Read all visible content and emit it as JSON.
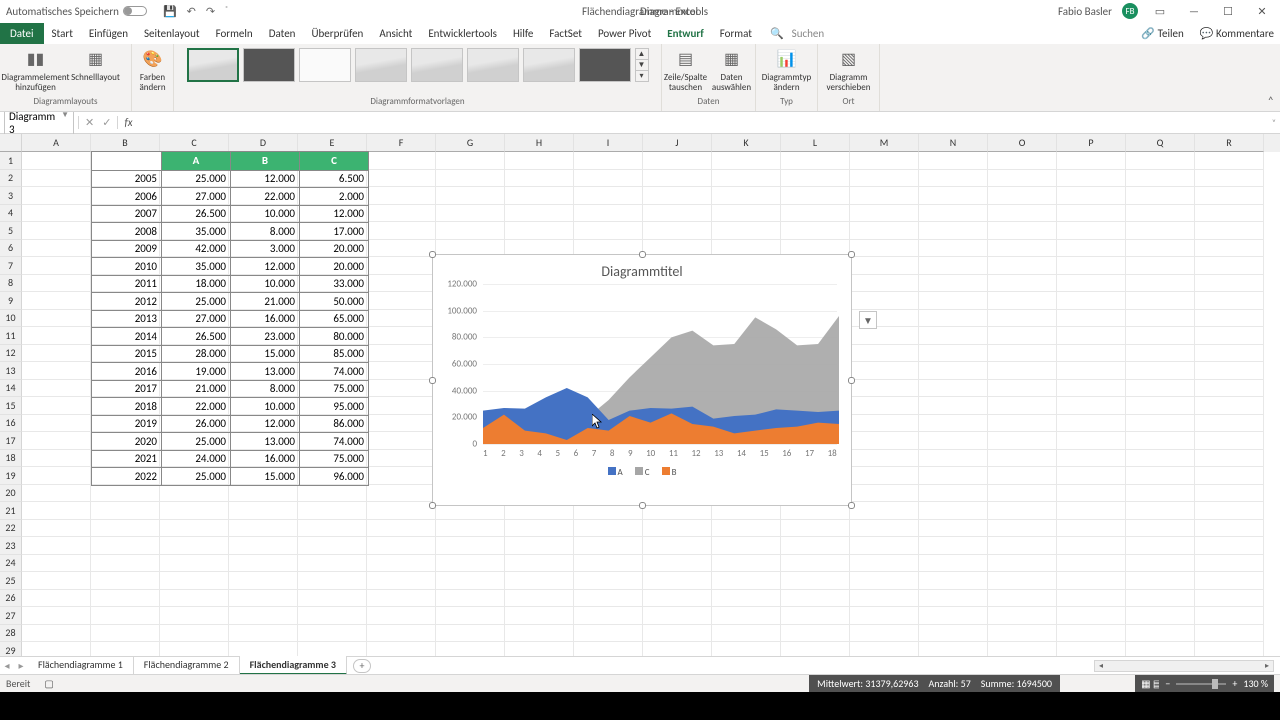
{
  "title_bar": {
    "autosave_label": "Automatisches Speichern",
    "doc_title": "Flächendiagramme - Excel",
    "context_tab": "Diagrammtools",
    "user_name": "Fabio Basler",
    "user_initials": "FB"
  },
  "tabs": {
    "file": "Datei",
    "items": [
      "Start",
      "Einfügen",
      "Seitenlayout",
      "Formeln",
      "Daten",
      "Überprüfen",
      "Ansicht",
      "Entwicklertools",
      "Hilfe",
      "FactSet",
      "Power Pivot",
      "Entwurf",
      "Format"
    ],
    "active": "Entwurf",
    "search": "Suchen",
    "share": "Teilen",
    "comments": "Kommentare"
  },
  "ribbon": {
    "layouts_btn1": "Diagrammelement hinzufügen",
    "layouts_btn2": "Schnelllayout",
    "layouts_label": "Diagrammlayouts",
    "colors_btn": "Farben ändern",
    "styles_label": "Diagrammformatvorlagen",
    "data_btn1": "Zeile/Spalte tauschen",
    "data_btn2": "Daten auswählen",
    "data_label": "Daten",
    "type_btn": "Diagrammtyp ändern",
    "type_label": "Typ",
    "loc_btn": "Diagramm verschieben",
    "loc_label": "Ort"
  },
  "fx": {
    "name_box": "Diagramm 3",
    "formula": ""
  },
  "columns": [
    "A",
    "B",
    "C",
    "D",
    "E",
    "F",
    "G",
    "H",
    "I",
    "J",
    "K",
    "L",
    "M",
    "N",
    "O",
    "P",
    "Q",
    "R"
  ],
  "row_count": 29,
  "table": {
    "headers": [
      "",
      "A",
      "B",
      "C"
    ],
    "rows": [
      [
        "2005",
        "25.000",
        "12.000",
        "6.500"
      ],
      [
        "2006",
        "27.000",
        "22.000",
        "2.000"
      ],
      [
        "2007",
        "26.500",
        "10.000",
        "12.000"
      ],
      [
        "2008",
        "35.000",
        "8.000",
        "17.000"
      ],
      [
        "2009",
        "42.000",
        "3.000",
        "20.000"
      ],
      [
        "2010",
        "35.000",
        "12.000",
        "20.000"
      ],
      [
        "2011",
        "18.000",
        "10.000",
        "33.000"
      ],
      [
        "2012",
        "25.000",
        "21.000",
        "50.000"
      ],
      [
        "2013",
        "27.000",
        "16.000",
        "65.000"
      ],
      [
        "2014",
        "26.500",
        "23.000",
        "80.000"
      ],
      [
        "2015",
        "28.000",
        "15.000",
        "85.000"
      ],
      [
        "2016",
        "19.000",
        "13.000",
        "74.000"
      ],
      [
        "2017",
        "21.000",
        "8.000",
        "75.000"
      ],
      [
        "2018",
        "22.000",
        "10.000",
        "95.000"
      ],
      [
        "2019",
        "26.000",
        "12.000",
        "86.000"
      ],
      [
        "2020",
        "25.000",
        "13.000",
        "74.000"
      ],
      [
        "2021",
        "24.000",
        "16.000",
        "75.000"
      ],
      [
        "2022",
        "25.000",
        "15.000",
        "96.000"
      ]
    ]
  },
  "chart_data": {
    "type": "area",
    "title": "Diagrammtitel",
    "x": [
      1,
      2,
      3,
      4,
      5,
      6,
      7,
      8,
      9,
      10,
      11,
      12,
      13,
      14,
      15,
      16,
      17,
      18
    ],
    "series": [
      {
        "name": "A",
        "color": "#4472c4",
        "values": [
          25000,
          27000,
          26500,
          35000,
          42000,
          35000,
          18000,
          25000,
          27000,
          26500,
          28000,
          19000,
          21000,
          22000,
          26000,
          25000,
          24000,
          25000
        ]
      },
      {
        "name": "C",
        "color": "#a6a6a6",
        "values": [
          6500,
          2000,
          12000,
          17000,
          20000,
          20000,
          33000,
          50000,
          65000,
          80000,
          85000,
          74000,
          75000,
          95000,
          86000,
          74000,
          75000,
          96000
        ]
      },
      {
        "name": "B",
        "color": "#ed7d31",
        "values": [
          12000,
          22000,
          10000,
          8000,
          3000,
          12000,
          10000,
          21000,
          16000,
          23000,
          15000,
          13000,
          8000,
          10000,
          12000,
          13000,
          16000,
          15000
        ]
      }
    ],
    "ylim": [
      0,
      120000
    ],
    "y_ticks": [
      0,
      20000,
      40000,
      60000,
      80000,
      100000,
      120000
    ],
    "y_tick_labels": [
      "0",
      "20.000",
      "40.000",
      "60.000",
      "80.000",
      "100.000",
      "120.000"
    ],
    "legend": [
      "A",
      "C",
      "B"
    ]
  },
  "sheet_tabs": {
    "items": [
      "Flächendiagramme 1",
      "Flächendiagramme 2",
      "Flächendiagramme 3"
    ],
    "active": 2
  },
  "status": {
    "ready": "Bereit",
    "avg_label": "Mittelwert:",
    "avg": "31379,62963",
    "count_label": "Anzahl:",
    "count": "57",
    "sum_label": "Summe:",
    "sum": "1694500",
    "zoom": "130 %"
  }
}
